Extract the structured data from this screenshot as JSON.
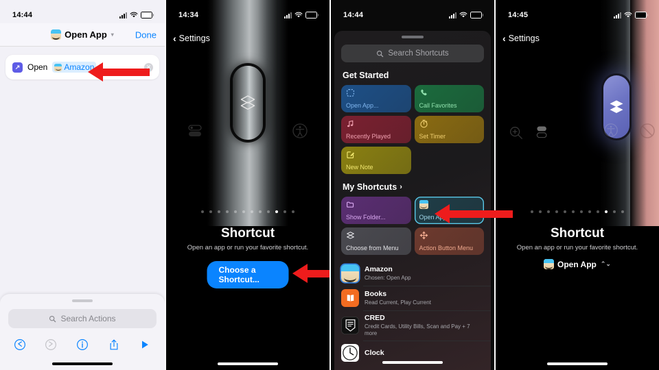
{
  "panel1": {
    "status": {
      "time": "14:44",
      "battery": "81"
    },
    "navbar": {
      "title": "Open App",
      "app_icon": "amazon-icon",
      "chevron": "chevron-down-icon",
      "done_label": "Done"
    },
    "action_card": {
      "icon": "open-app-action-icon",
      "verb": "Open",
      "app": "Amazon",
      "app_icon": "amazon-icon",
      "clear": "clear-icon"
    },
    "sheet": {
      "search_placeholder": "Search Actions"
    },
    "toolbar": [
      {
        "name": "undo-icon",
        "label": "Undo",
        "state": "enabled"
      },
      {
        "name": "redo-icon",
        "label": "Redo",
        "state": "disabled"
      },
      {
        "name": "info-icon",
        "label": "Info",
        "state": "enabled"
      },
      {
        "name": "share-icon",
        "label": "Share",
        "state": "enabled"
      },
      {
        "name": "play-icon",
        "label": "Run",
        "state": "enabled"
      }
    ]
  },
  "panel2": {
    "status": {
      "time": "14:34",
      "battery": "81"
    },
    "back_label": "Settings",
    "button_glyph": "shortcuts-stack-icon",
    "dots": {
      "count": 12,
      "active_index": 9
    },
    "title": "Shortcut",
    "subtitle": "Open an app or run your favorite shortcut.",
    "cta_label": "Choose a Shortcut..."
  },
  "panel3": {
    "status": {
      "time": "14:44",
      "battery": "81"
    },
    "search_placeholder": "Search Shortcuts",
    "sections": [
      {
        "title": "Get Started",
        "chevron": "",
        "tiles": [
          {
            "label": "Open App...",
            "icon": "dashed-square-icon",
            "color": "#1d4f86",
            "text": "#7fb5ee",
            "selected": false
          },
          {
            "label": "Call Favorites",
            "icon": "phone-icon",
            "color": "#1b6b3d",
            "text": "#8fe0ac",
            "selected": false
          },
          {
            "label": "Recently Played",
            "icon": "music-note-icon",
            "color": "#7a2030",
            "text": "#f0a0b0",
            "selected": false
          },
          {
            "label": "Set Timer",
            "icon": "timer-icon",
            "color": "#8a6b12",
            "text": "#f0cf70",
            "selected": false
          },
          {
            "label": "New Note",
            "icon": "note-pencil-icon",
            "color": "#8a8012",
            "text": "#f2e870",
            "selected": false
          }
        ]
      },
      {
        "title": "My Shortcuts",
        "chevron": "›",
        "tiles": [
          {
            "label": "Show Folder...",
            "icon": "folder-icon",
            "color": "#5a2e72",
            "text": "#d9a8f0",
            "selected": false
          },
          {
            "label": "Open App",
            "icon": "amazon-icon",
            "color": "#1f3d47",
            "text": "#9fd6e8",
            "selected": true
          },
          {
            "label": "Choose from Menu",
            "icon": "stack-icon",
            "color": "#4a4a50",
            "text": "#e4e4e8",
            "selected": false
          },
          {
            "label": "Action Button Menu",
            "icon": "move-arrows-icon",
            "color": "#6d3a2e",
            "text": "#f0a98e",
            "selected": false
          }
        ]
      }
    ],
    "apps": [
      {
        "name": "Amazon",
        "sub": "Chosen: Open App",
        "icon": "amazon-icon",
        "selected": true
      },
      {
        "name": "Books",
        "sub": "Read Current, Play Current",
        "icon": "books-icon",
        "selected": false
      },
      {
        "name": "CRED",
        "sub": "Credit Cards, Utility Bills, Scan and Pay + 7 more",
        "icon": "cred-icon",
        "selected": false
      },
      {
        "name": "Clock",
        "sub": "",
        "icon": "clock-icon",
        "selected": false
      }
    ]
  },
  "panel4": {
    "status": {
      "time": "14:45",
      "battery": "81"
    },
    "back_label": "Settings",
    "button_glyph": "shortcuts-stack-icon",
    "side_glyphs": [
      "magnifier-icon",
      "silent-toggle-icon",
      "accessibility-icon",
      "do-not-disturb-icon"
    ],
    "dots": {
      "count": 12,
      "active_index": 9
    },
    "title": "Shortcut",
    "subtitle": "Open an app or run your favorite shortcut.",
    "chosen": {
      "label": "Open App",
      "icon": "amazon-icon",
      "stepper": "up-down-chevron-icon"
    }
  },
  "colors": {
    "accent_blue": "#0a84ff",
    "arrow_red": "#ee1c1c",
    "selection_cyan": "#5ac8e8",
    "panel1_bg": "#f2f1f7"
  }
}
